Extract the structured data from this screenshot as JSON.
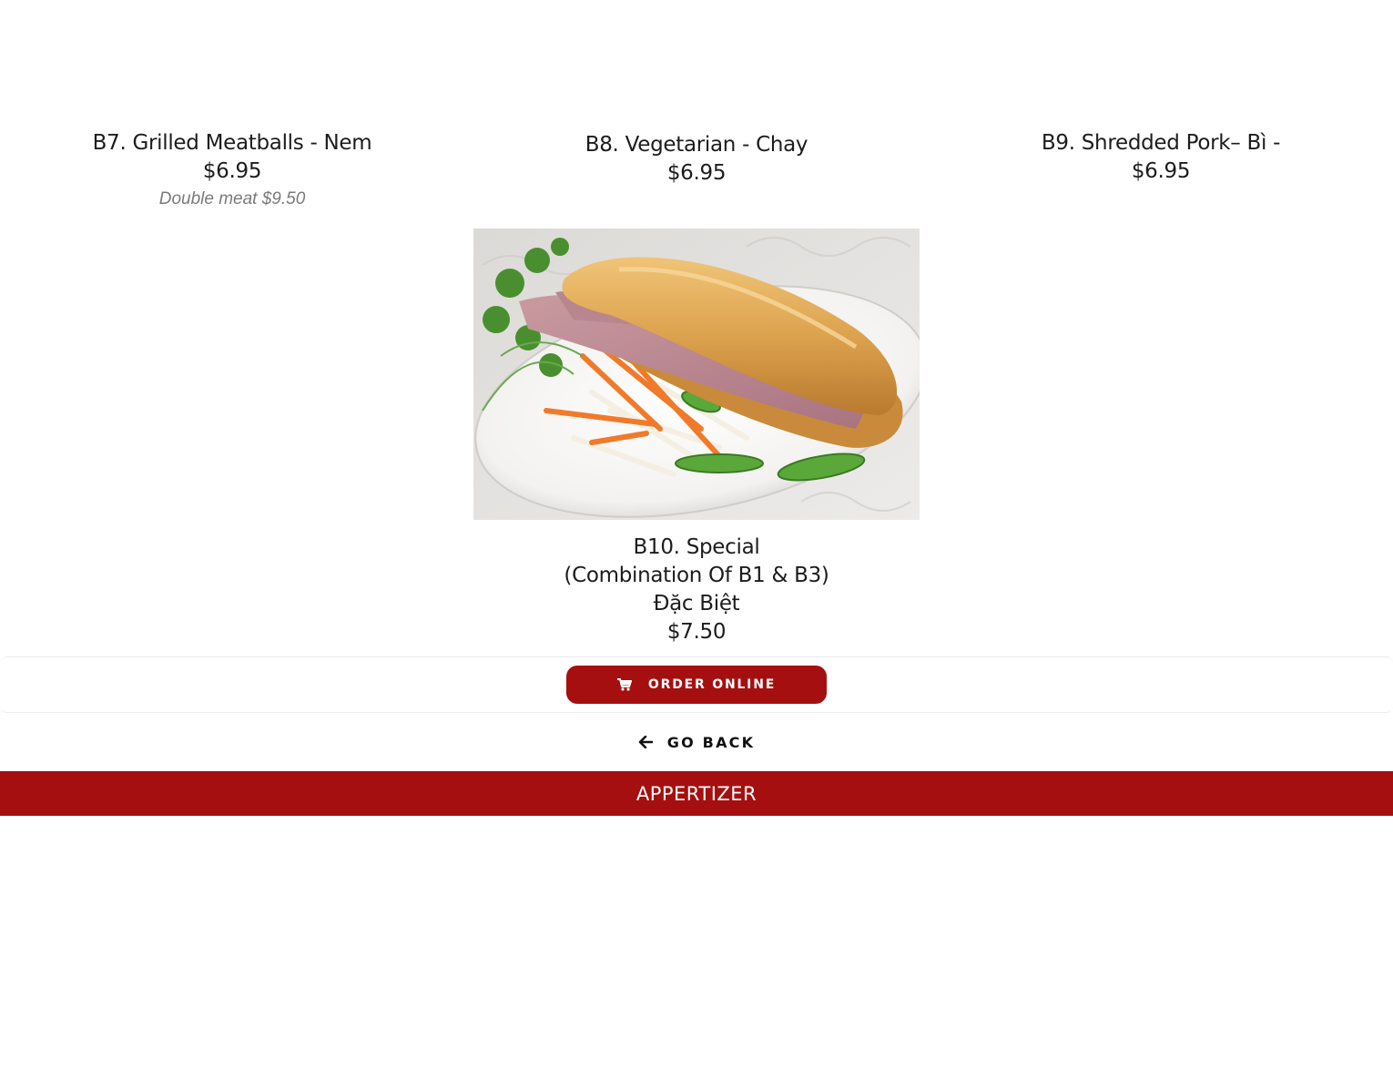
{
  "menu": {
    "items": [
      {
        "title": "B7. Grilled Meatballs - Nem",
        "price": "$6.95",
        "note": "Double meat $9.50"
      },
      {
        "title": "B8. Vegetarian - Chay",
        "price": "$6.95"
      },
      {
        "title": "B9. Shredded Pork– Bì -",
        "price": "$6.95"
      },
      {
        "title_lines": [
          "B10. Special",
          "(Combination Of B1 & B3)",
          "Đặc Biệt"
        ],
        "price": "$7.50"
      }
    ]
  },
  "actions": {
    "order_label": "ORDER ONLINE",
    "order_icon": "cart-icon",
    "back_label": "GO BACK",
    "back_icon": "arrow-left-icon"
  },
  "section": {
    "label": "APPERTIZER"
  },
  "colors": {
    "brand_red": "#a50f10",
    "text_dark": "#1c1c1c",
    "note_gray": "#7a7a7a"
  }
}
